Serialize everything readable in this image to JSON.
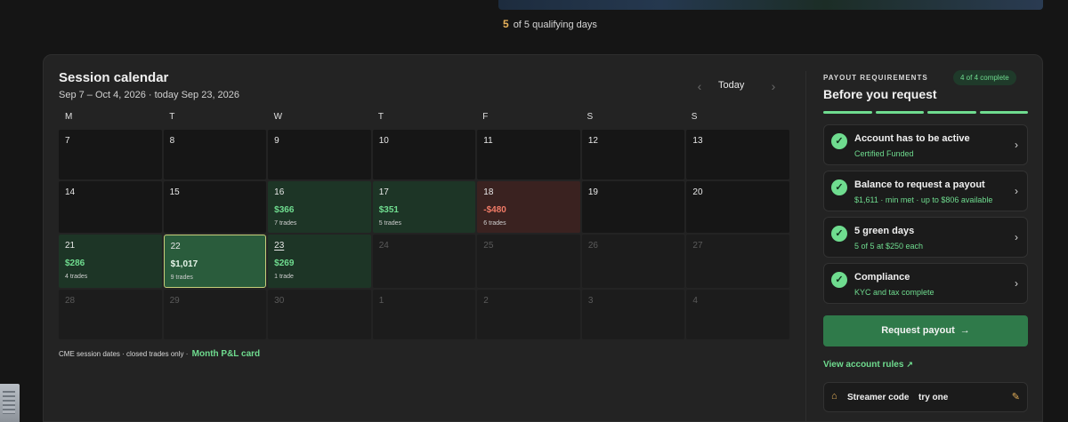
{
  "qualifying": {
    "count": "5",
    "text": "of 5 qualifying days"
  },
  "calendar": {
    "title": "Session calendar",
    "range": "Sep 7 – Oct 4, 2026 · today Sep 23, 2026",
    "nav": {
      "prev": "‹",
      "today": "Today",
      "next": "›"
    },
    "weekdays": [
      "M",
      "T",
      "W",
      "T",
      "F",
      "S",
      "S"
    ],
    "days": [
      {
        "d": "7",
        "state": "past"
      },
      {
        "d": "8",
        "state": "past"
      },
      {
        "d": "9",
        "state": "past"
      },
      {
        "d": "10",
        "state": "past"
      },
      {
        "d": "11",
        "state": "past"
      },
      {
        "d": "12",
        "state": "past"
      },
      {
        "d": "13",
        "state": "past"
      },
      {
        "d": "14",
        "state": "past"
      },
      {
        "d": "15",
        "state": "past"
      },
      {
        "d": "16",
        "state": "win",
        "pnl": "$366",
        "trades": "7 trades"
      },
      {
        "d": "17",
        "state": "win",
        "pnl": "$351",
        "trades": "5 trades"
      },
      {
        "d": "18",
        "state": "loss",
        "pnl": "-$480",
        "trades": "6 trades"
      },
      {
        "d": "19",
        "state": "past"
      },
      {
        "d": "20",
        "state": "past"
      },
      {
        "d": "21",
        "state": "win",
        "pnl": "$286",
        "trades": "4 trades"
      },
      {
        "d": "22",
        "state": "sel",
        "pnl": "$1,017",
        "trades": "9 trades"
      },
      {
        "d": "23",
        "state": "win today",
        "pnl": "$269",
        "trades": "1 trade"
      },
      {
        "d": "24",
        "state": "future"
      },
      {
        "d": "25",
        "state": "future"
      },
      {
        "d": "26",
        "state": "future"
      },
      {
        "d": "27",
        "state": "future"
      },
      {
        "d": "28",
        "state": "future"
      },
      {
        "d": "29",
        "state": "future"
      },
      {
        "d": "30",
        "state": "future"
      },
      {
        "d": "1",
        "state": "future"
      },
      {
        "d": "2",
        "state": "future"
      },
      {
        "d": "3",
        "state": "future"
      },
      {
        "d": "4",
        "state": "future"
      }
    ],
    "footnote": "CME session dates · closed trades only ·",
    "footnote_link": "Month P&L card"
  },
  "payout": {
    "kicker": "PAYOUT REQUIREMENTS",
    "badge": "4 of 4 complete",
    "title": "Before you request",
    "progress_complete": 4,
    "progress_total": 4,
    "requirements": [
      {
        "title": "Account has to be active",
        "sub": "Certified Funded"
      },
      {
        "title": "Balance to request a payout",
        "sub": "$1,611 · min met · up to $806 available"
      },
      {
        "title": "5 green days",
        "sub": "5 of 5 at $250 each"
      },
      {
        "title": "Compliance",
        "sub": "KYC and tax complete"
      }
    ],
    "request_label": "Request payout",
    "rules_link": "View account rules",
    "streamer_label": "Streamer code",
    "streamer_action": "try one"
  },
  "colors": {
    "accent_green": "#6fdc8f",
    "loss_red": "#f07a66",
    "gold": "#e6b15a",
    "button_green": "#2f7a4a"
  },
  "icons": [
    "check-icon",
    "chevron-right-icon",
    "arrow-right-icon",
    "external-link-icon",
    "tag-icon",
    "pencil-icon",
    "chevron-left-icon"
  ]
}
